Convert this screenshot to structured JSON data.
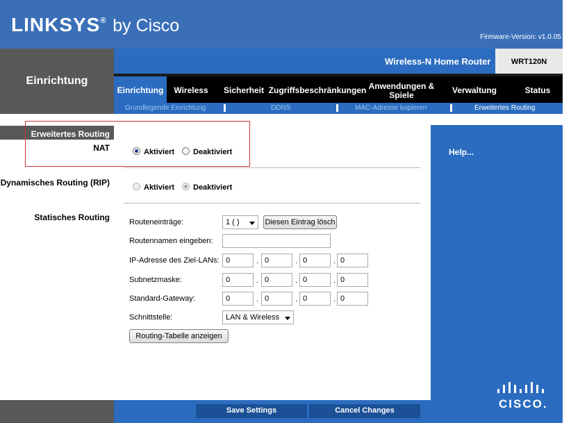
{
  "header": {
    "brand_main": "LINKSYS",
    "brand_reg": "®",
    "brand_by": "by Cisco",
    "firmware": "Firmware-Version: v1.0.05",
    "router_name": "Wireless-N Home Router",
    "model": "WRT120N"
  },
  "section_title": "Einrichtung",
  "tabs": [
    {
      "label": "Einrichtung"
    },
    {
      "label": "Wireless"
    },
    {
      "label": "Sicherheit"
    },
    {
      "label": "Zugriffsbeschränkungen"
    },
    {
      "label": "Anwendungen &"
    },
    {
      "label": "Spiele"
    },
    {
      "label": "Verwaltung"
    },
    {
      "label": "Status"
    }
  ],
  "subtabs": [
    {
      "label": "Grundlegende Einrichtung"
    },
    {
      "label": "DDNS"
    },
    {
      "label": "MAC-Adresse kopieren"
    },
    {
      "label": "Erweitertes Routing"
    }
  ],
  "left": {
    "section_bar": "Erweitertes Routing",
    "nat": "NAT",
    "rip": "Dynamisches Routing (RIP)",
    "static": "Statisches Routing"
  },
  "nat": {
    "enabled": "Aktiviert",
    "disabled": "Deaktiviert"
  },
  "rip": {
    "enabled": "Aktiviert",
    "disabled": "Deaktiviert"
  },
  "static_routing": {
    "entries_label": "Routeneinträge:",
    "entries_value": "1 ( )",
    "delete_button": "Diesen Eintrag lösch",
    "name_label": "Routennamen eingeben:",
    "name_value": "",
    "dest_label": "IP-Adresse des Ziel-LANs:",
    "dest": [
      "0",
      "0",
      "0",
      "0"
    ],
    "mask_label": "Subnetzmaske:",
    "mask": [
      "0",
      "0",
      "0",
      "0"
    ],
    "gateway_label": "Standard-Gateway:",
    "gateway": [
      "0",
      "0",
      "0",
      "0"
    ],
    "iface_label": "Schnittstelle:",
    "iface_value": "LAN & Wireless",
    "show_table_button": "Routing-Tabelle anzeigen",
    "ip_separator": "."
  },
  "help": "Help...",
  "footer": {
    "save": "Save Settings",
    "cancel": "Cancel Changes"
  },
  "cisco_logo": "CISCO.",
  "colors": {
    "header_blue": "#3a6fb8",
    "nav_blue": "#2b6cc0",
    "sidebar_gray": "#585858",
    "annotation_red": "#c8323c"
  }
}
